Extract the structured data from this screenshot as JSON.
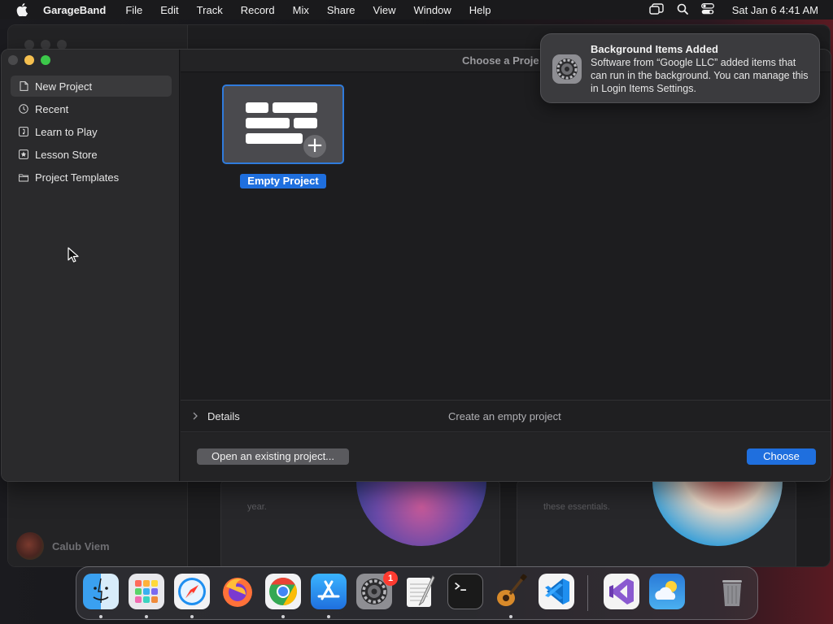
{
  "menubar": {
    "app_name": "GarageBand",
    "items": [
      "File",
      "Edit",
      "Track",
      "Record",
      "Mix",
      "Share",
      "View",
      "Window",
      "Help"
    ],
    "clock": "Sat Jan 6  4:41 AM",
    "icons": [
      "apple-icon",
      "screen-mirroring-icon",
      "spotlight-search-icon",
      "control-center-icon"
    ]
  },
  "window": {
    "title": "Choose a Proje",
    "sidebar": {
      "items": [
        {
          "label": "New Project",
          "icon": "new-project-icon",
          "selected": true
        },
        {
          "label": "Recent",
          "icon": "clock-icon"
        },
        {
          "label": "Learn to Play",
          "icon": "learn-icon"
        },
        {
          "label": "Lesson Store",
          "icon": "star-icon"
        },
        {
          "label": "Project Templates",
          "icon": "folder-icon"
        }
      ]
    },
    "project": {
      "label": "Empty Project"
    },
    "details": {
      "label": "Details",
      "description": "Create an empty project"
    },
    "footer": {
      "open_label": "Open an existing project...",
      "choose_label": "Choose"
    }
  },
  "background_window": {
    "user_name": "Calub Viem",
    "card_texts": [
      "year.",
      "these essentials."
    ]
  },
  "notification": {
    "title": "Background Items Added",
    "body": "Software from “Google LLC” added items that can run in the background. You can manage this in Login Items Settings.",
    "icon": "system-settings-icon"
  },
  "dock": {
    "apps": [
      {
        "name": "Finder",
        "icon": "finder-icon",
        "running": true
      },
      {
        "name": "Launchpad",
        "icon": "launchpad-icon",
        "running": true
      },
      {
        "name": "Safari",
        "icon": "safari-icon",
        "running": true
      },
      {
        "name": "Firefox",
        "icon": "firefox-icon",
        "running": false
      },
      {
        "name": "Chrome",
        "icon": "chrome-icon",
        "running": true
      },
      {
        "name": "App Store",
        "icon": "app-store-icon",
        "running": true
      },
      {
        "name": "System Settings",
        "icon": "system-settings-icon",
        "badge": "1",
        "running": false
      },
      {
        "name": "TextEdit",
        "icon": "textedit-icon",
        "running": false
      },
      {
        "name": "Terminal",
        "icon": "terminal-icon",
        "running": false
      },
      {
        "name": "GarageBand",
        "icon": "garageband-icon",
        "running": true
      },
      {
        "name": "VS Code",
        "icon": "vscode-icon",
        "running": false
      },
      {
        "name": "Visual Studio",
        "icon": "visual-studio-icon",
        "running": false
      },
      {
        "name": "Weather",
        "icon": "weather-icon",
        "running": false
      },
      {
        "name": "Trash",
        "icon": "trash-icon",
        "running": false
      }
    ]
  },
  "colors": {
    "accent": "#1f6fde",
    "close": "#4a4a4c",
    "minimize": "#f5bf4f",
    "maximize": "#3cc84a",
    "badge": "#ff3b30"
  }
}
